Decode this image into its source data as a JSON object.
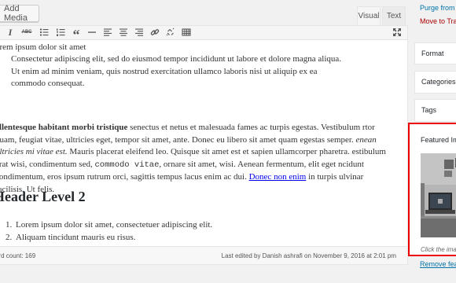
{
  "header": {
    "add_media": "Add Media",
    "tab_visual": "Visual",
    "tab_text": "Text"
  },
  "toolbar": {
    "icons": [
      "italic-icon",
      "strikethrough-icon",
      "bullet-list-icon",
      "numbered-list-icon",
      "blockquote-icon",
      "horizontal-rule-icon",
      "align-left-icon",
      "align-center-icon",
      "align-right-icon",
      "insert-link-icon",
      "remove-link-icon",
      "toolbar-toggle-icon",
      "fullscreen-icon"
    ],
    "italic": "I",
    "strikethrough": "ABC",
    "blockquote": "“"
  },
  "content": {
    "intro": "orem ipsum dolor sit amet",
    "blockquote": "Consectetur adipiscing elit, sed do eiusmod tempor incididunt ut labore et dolore magna aliqua. Ut enim ad minim veniam, quis nostrud exercitation ullamco laboris nisi ut aliquip ex ea commodo consequat.",
    "p_bold": "ellentesque habitant morbi tristique",
    "p_text1": " senectus et netus et malesuada fames ac turpis egestas. Vestibulum rtor quam, feugiat vitae, ultricies eget, tempor sit amet, ante. Donec eu libero sit amet quam egestas semper. ",
    "p_italic": "enean ultricies mi vitae est.",
    "p_text2": " Mauris placerat eleifend leo. Quisque sit amet est et sapien ullamcorper pharetra. estibulum erat wisi, condimentum sed, ",
    "p_code": "commodo vitae",
    "p_text3": ", ornare sit amet, wisi. Aenean fermentum, elit eget ncidunt condimentum, eros ipsum rutrum orci, sagittis tempus lacus enim ac dui. ",
    "p_link": "Donec non enim",
    "p_text4": " in turpis ulvinar facilisis. Ut felis.",
    "heading": "Header Level 2",
    "list": [
      "Lorem ipsum dolor sit amet, consectetuer adipiscing elit.",
      "Aliquam tincidunt mauris eu risus."
    ]
  },
  "status": {
    "word_count": "ord count: 169",
    "last_edited": "Last edited by Danish ashrafi on November 9, 2016 at 2:01 pm"
  },
  "sidebar": {
    "purge_link": "Purge from c",
    "trash_link": "Move to Tras",
    "format_title": "Format",
    "categories_title": "Categories",
    "tags_title": "Tags",
    "featured_title": "Featured Im",
    "featured_caption": "Click the ima",
    "remove_featured": "Remove feat"
  },
  "colors": {
    "link": "#0073aa",
    "trash": "#a00",
    "highlight_border": "#e00"
  }
}
